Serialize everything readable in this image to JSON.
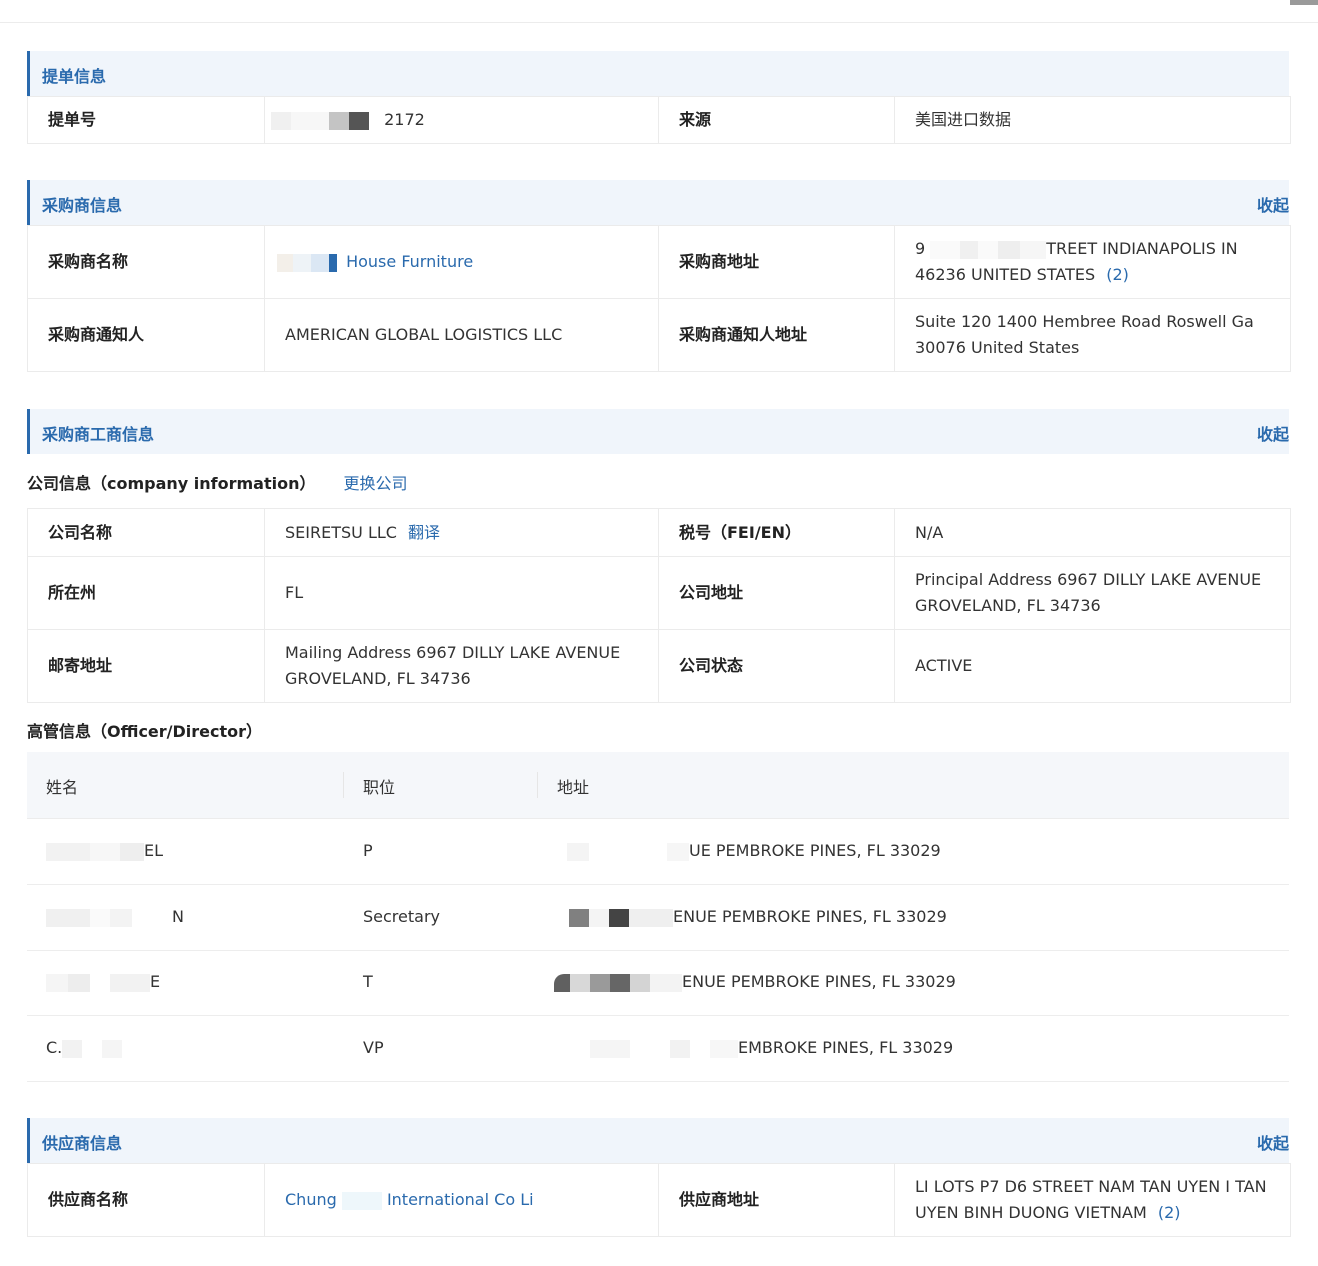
{
  "bill": {
    "title": "提单信息",
    "bill_no_label": "提单号",
    "bill_no_value": "2172",
    "source_label": "来源",
    "source_value": "美国进口数据"
  },
  "buyer": {
    "title": "采购商信息",
    "collapse": "收起",
    "name_label": "采购商名称",
    "name_value": "House Furniture",
    "address_label": "采购商地址",
    "address_line1": "9",
    "address_line1b": "TREET INDIANAPOLIS IN",
    "address_line2": "46236 UNITED STATES",
    "address_count": "(2)",
    "notify_label": "采购商通知人",
    "notify_value": "AMERICAN GLOBAL LOGISTICS LLC",
    "notify_addr_label": "采购商通知人地址",
    "notify_addr_line1": "Suite 120 1400 Hembree Road Roswell Ga",
    "notify_addr_line2": "30076 United States"
  },
  "biz": {
    "title": "采购商工商信息",
    "collapse": "收起",
    "company_info_label": "公司信息（company information）",
    "change_company": "更换公司",
    "company_name_label": "公司名称",
    "company_name_value": "SEIRETSU LLC",
    "translate": "翻译",
    "tax_label": "税号（FEI/EN）",
    "tax_value": "N/A",
    "state_label": "所在州",
    "state_value": "FL",
    "company_addr_label": "公司地址",
    "company_addr_line1": "Principal Address 6967 DILLY LAKE AVENUE",
    "company_addr_line2": "GROVELAND, FL 34736",
    "mail_label": "邮寄地址",
    "mail_line1": "Mailing Address 6967 DILLY LAKE AVENUE",
    "mail_line2": "GROVELAND, FL 34736",
    "status_label": "公司状态",
    "status_value": "ACTIVE"
  },
  "officers": {
    "title": "高管信息（Officer/Director）",
    "headers": {
      "name": "姓名",
      "position": "职位",
      "address": "地址"
    },
    "rows": [
      {
        "name": "EL",
        "position": "P",
        "address": "UE PEMBROKE PINES, FL 33029"
      },
      {
        "name": "N",
        "position": "Secretary",
        "address": "ENUE PEMBROKE PINES, FL 33029"
      },
      {
        "name": "E",
        "position": "T",
        "address": "ENUE PEMBROKE PINES, FL 33029"
      },
      {
        "name": "C.",
        "position": "VP",
        "address": "EMBROKE PINES, FL 33029"
      }
    ]
  },
  "supplier": {
    "title": "供应商信息",
    "collapse": "收起",
    "name_label": "供应商名称",
    "name_part1": "Chung",
    "name_part2": "International Co Li",
    "address_label": "供应商地址",
    "address_line1": "LI LOTS P7 D6 STREET NAM TAN UYEN I TAN",
    "address_line2": "UYEN BINH DUONG VIETNAM",
    "address_count": "(2)"
  }
}
